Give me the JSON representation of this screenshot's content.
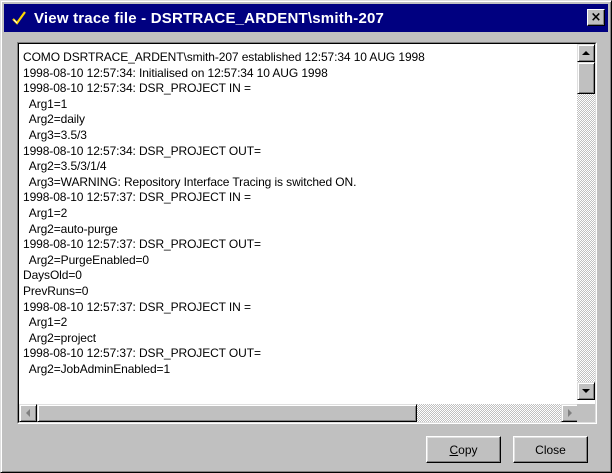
{
  "window": {
    "title": "View trace file - DSRTRACE_ARDENT\\smith-207",
    "icon": "pencil-check-icon",
    "close_label": "×"
  },
  "log": {
    "lines": [
      "COMO DSRTRACE_ARDENT\\smith-207 established 12:57:34 10 AUG 1998",
      "1998-08-10 12:57:34: Initialised on 12:57:34 10 AUG 1998",
      "1998-08-10 12:57:34: DSR_PROJECT IN =",
      "  Arg1=1",
      "  Arg2=daily",
      "  Arg3=3.5/3",
      "1998-08-10 12:57:34: DSR_PROJECT OUT=",
      "  Arg2=3.5/3/1/4",
      "  Arg3=WARNING: Repository Interface Tracing is switched ON.",
      "1998-08-10 12:57:37: DSR_PROJECT IN =",
      "  Arg1=2",
      "  Arg2=auto-purge",
      "1998-08-10 12:57:37: DSR_PROJECT OUT=",
      "  Arg2=PurgeEnabled=0",
      "DaysOld=0",
      "PrevRuns=0",
      "1998-08-10 12:57:37: DSR_PROJECT IN =",
      "  Arg1=2",
      "  Arg2=project",
      "1998-08-10 12:57:37: DSR_PROJECT OUT=",
      "  Arg2=JobAdminEnabled=1"
    ]
  },
  "buttons": {
    "copy_mnemonic": "C",
    "copy_rest": "opy",
    "close_label": "Close"
  }
}
